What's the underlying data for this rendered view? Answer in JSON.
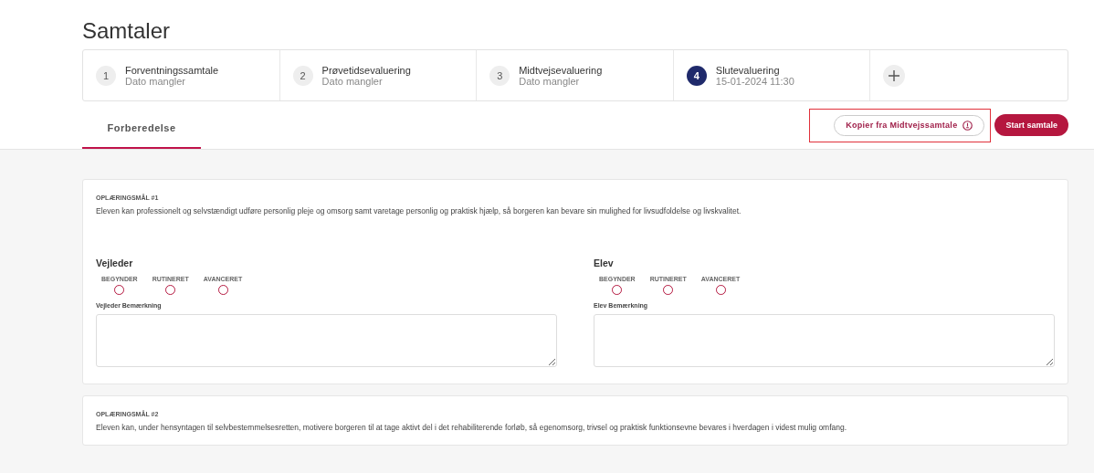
{
  "title": "Samtaler",
  "steps": [
    {
      "number": "1",
      "name": "Forventningssamtale",
      "date": "Dato mangler",
      "selected": false
    },
    {
      "number": "2",
      "name": "Prøvetidsevaluering",
      "date": "Dato mangler",
      "selected": false
    },
    {
      "number": "3",
      "name": "Midtvejsevaluering",
      "date": "Dato mangler",
      "selected": false
    },
    {
      "number": "4",
      "name": "Slutevaluering",
      "date": "15-01-2024 11:30",
      "selected": true
    }
  ],
  "tabs": [
    {
      "label": "Forberedelse",
      "selected": true
    }
  ],
  "copy_button": {
    "label": "Kopier fra Midtvejssamtale",
    "highlighted": true
  },
  "start_button": {
    "label": "Start samtale"
  },
  "goals": [
    {
      "heading": "OPLÆRINGSMÅL #1",
      "text": "Eleven kan professionelt og selvstændigt udføre personlig pleje og omsorg samt varetage personlig og praktisk hjælp, så borgeren kan bevare sin mulighed for livsudfoldelse og livskvalitet.",
      "assessments": [
        {
          "title": "Vejleder",
          "options": [
            {
              "label": "BEGYNDER",
              "selected": false
            },
            {
              "label": "RUTINERET",
              "selected": false
            },
            {
              "label": "AVANCERET",
              "selected": false
            }
          ],
          "remark_label": "Vejleder Bemærkning"
        },
        {
          "title": "Elev",
          "options": [
            {
              "label": "BEGYNDER",
              "selected": false
            },
            {
              "label": "RUTINERET",
              "selected": false
            },
            {
              "label": "AVANCERET",
              "selected": false
            }
          ],
          "remark_label": "Elev Bemærkning"
        }
      ]
    },
    {
      "heading": "OPLÆRINGSMÅL #2",
      "text": "Eleven kan, under hensyntagen til selvbestemmelsesretten, motivere borgeren til at tage aktivt del i det rehabiliterende forløb, så egenomsorg, trivsel og praktisk funktionsevne bevares i hverdagen i videst mulig omfang."
    }
  ]
}
